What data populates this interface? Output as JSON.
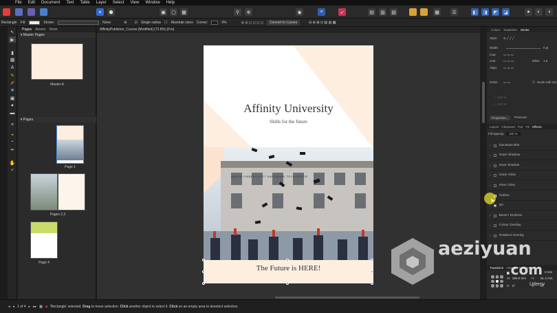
{
  "menu": [
    "File",
    "Edit",
    "Document",
    "Text",
    "Table",
    "Layer",
    "Select",
    "View",
    "Window",
    "Help"
  ],
  "context_bar": {
    "selection": "Rectangle",
    "fill_label": "Fill:",
    "stroke_label": "Stroke:",
    "stroke_value": "None",
    "single_radius": "Single radius",
    "absolute_sizes": "Absolute sizes",
    "corner_label": "Corner:",
    "corner_value": "0%",
    "convert_button": "Convert to Curves"
  },
  "left_panel": {
    "tabs": [
      "Pages",
      "Assets",
      "Stock"
    ],
    "master_section": "Master Pages",
    "master_label": "Master A",
    "pages_section": "Pages",
    "page_labels": [
      "Page 1",
      "Pages 2,3",
      "Page 4"
    ]
  },
  "document": {
    "tab_title": "AffinityPublisher_Course [Modified] (73.8%) [Fre]",
    "title": "Affinity University",
    "subtitle": "Skills for the future",
    "footer_text": "The Future is HERE!",
    "sign_text": "АВАНИ УНІВЕРСИТЕТ НАРОДНИХ ТЕХНОЛОГІЙ"
  },
  "right_panel": {
    "top_tabs": [
      "Colour",
      "Swatches",
      "Stroke"
    ],
    "style_label": "Style:",
    "width_label": "Width:",
    "width_value": "0 pt",
    "cap_label": "Cap:",
    "join_label": "Join:",
    "mitre_label": "Mitre:",
    "mitre_value": "1.5",
    "align_label": "Align:",
    "order_label": "Order:",
    "scale_label": "Scale with obj",
    "properties_button": "Properties...",
    "pressure_label": "Pressure",
    "fx_tabs": [
      "Layers",
      "Character",
      "Par",
      "TS",
      "Effects"
    ],
    "fill_opacity_label": "Fill Opacity:",
    "fill_opacity_value": "100 %",
    "effects": [
      "Gaussian Blur",
      "Outer Shadow",
      "Inner Shadow",
      "Outer Glow",
      "Inner Glow",
      "Outline",
      "3D",
      "Bevel / Emboss",
      "Colour Overlay",
      "Gradient Overlay"
    ],
    "bottom_tabs": [
      "Transform",
      "History",
      "Navigator"
    ],
    "w_label": "W:",
    "w_value": "265.6 mm",
    "h_label": "H:",
    "h_value": "51.4 mm",
    "y_value": "0 mm",
    "r_label": "R:",
    "r_value": "0°",
    "s_label": "S:",
    "s_value": "0°"
  },
  "status": {
    "page_indicator": "1 of 4",
    "message_parts": [
      "'Rectangle' selected. ",
      "Drag",
      " to move selection. ",
      "Click",
      " another object to select it. ",
      "Click",
      " on an empty area to deselect selection."
    ]
  },
  "watermark": {
    "brand": "aeziyuan",
    "sub": ".com",
    "udemy": "Udemy"
  },
  "colors": {
    "accent": "#4a8de3",
    "page_peach": "#fdeee0",
    "page_bg": "#ffffff"
  }
}
